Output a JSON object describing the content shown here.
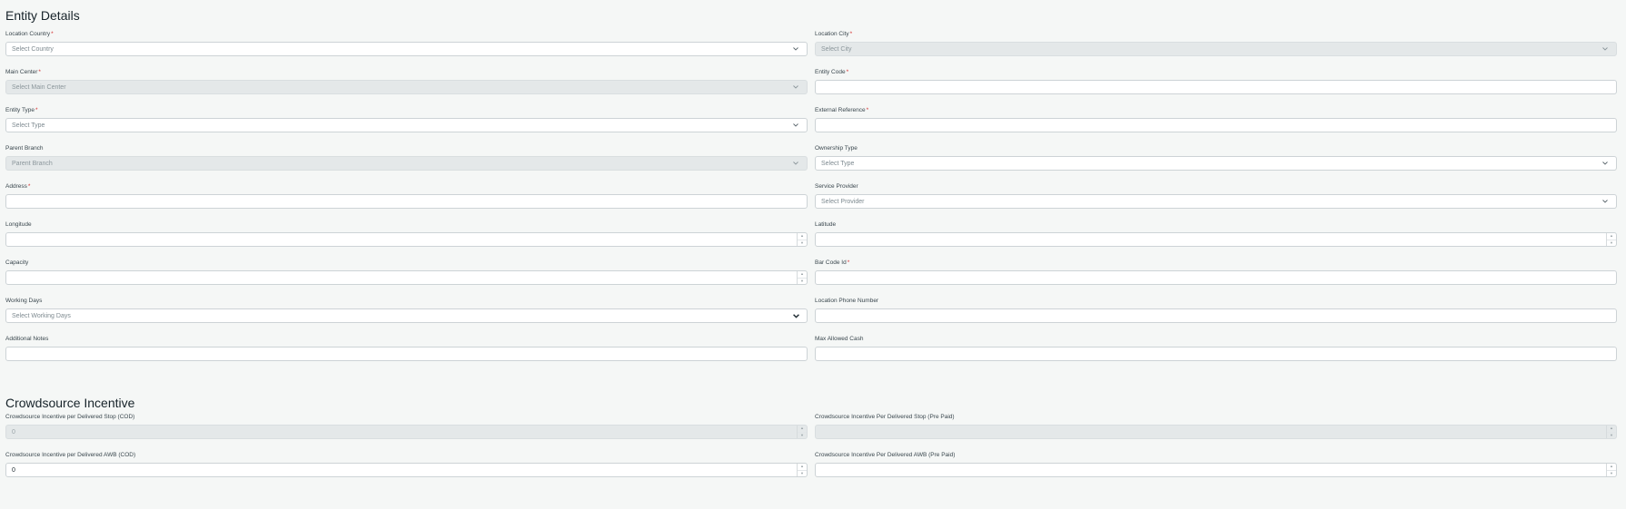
{
  "entity": {
    "title": "Entity Details",
    "fields": {
      "location_country": {
        "label": "Location Country",
        "placeholder": "Select Country"
      },
      "location_city": {
        "label": "Location City",
        "placeholder": "Select City"
      },
      "main_center": {
        "label": "Main Center",
        "placeholder": "Select Main Center"
      },
      "entity_code": {
        "label": "Entity Code",
        "value": ""
      },
      "entity_type": {
        "label": "Entity Type",
        "placeholder": "Select Type"
      },
      "external_reference": {
        "label": "External Reference",
        "value": ""
      },
      "parent_branch": {
        "label": "Parent Branch",
        "placeholder": "Parent Branch"
      },
      "ownership_type": {
        "label": "Ownership Type",
        "placeholder": "Select Type"
      },
      "address": {
        "label": "Address",
        "value": ""
      },
      "service_provider": {
        "label": "Service Provider",
        "placeholder": "Select Provider"
      },
      "longitude": {
        "label": "Longitude",
        "value": ""
      },
      "latitude": {
        "label": "Latitude",
        "value": ""
      },
      "capacity": {
        "label": "Capacity",
        "value": ""
      },
      "bar_code_id": {
        "label": "Bar Code Id",
        "value": ""
      },
      "working_days": {
        "label": "Working Days",
        "placeholder": "Select Working Days"
      },
      "location_phone": {
        "label": "Location Phone Number",
        "value": ""
      },
      "additional_notes": {
        "label": "Additional Notes",
        "value": ""
      },
      "max_allowed_cash": {
        "label": "Max Allowed Cash",
        "value": ""
      }
    }
  },
  "crowdsource": {
    "title": "Crowdsource Incentive",
    "fields": {
      "stop_cod": {
        "label": "Crowdsource Incentive per Delivered Stop (COD)",
        "value": "0"
      },
      "stop_prepaid": {
        "label": "Crowdsource Incentive Per Delivered Stop (Pre Paid)",
        "value": ""
      },
      "awb_cod": {
        "label": "Crowdsource Incentive per Delivered AWB (COD)",
        "value": "0"
      },
      "awb_prepaid": {
        "label": "Crowdsource Incentive Per Delivered AWB (Pre Paid)",
        "value": ""
      }
    }
  },
  "required_marker": "*",
  "icons": {
    "dropdown": "chevron-down-icon",
    "spinner_up": "spin-up-icon",
    "spinner_down": "spin-down-icon"
  },
  "colors": {
    "required": "#d32f2f",
    "background": "#f5f7f6",
    "disabled": "#e4e8e9"
  }
}
